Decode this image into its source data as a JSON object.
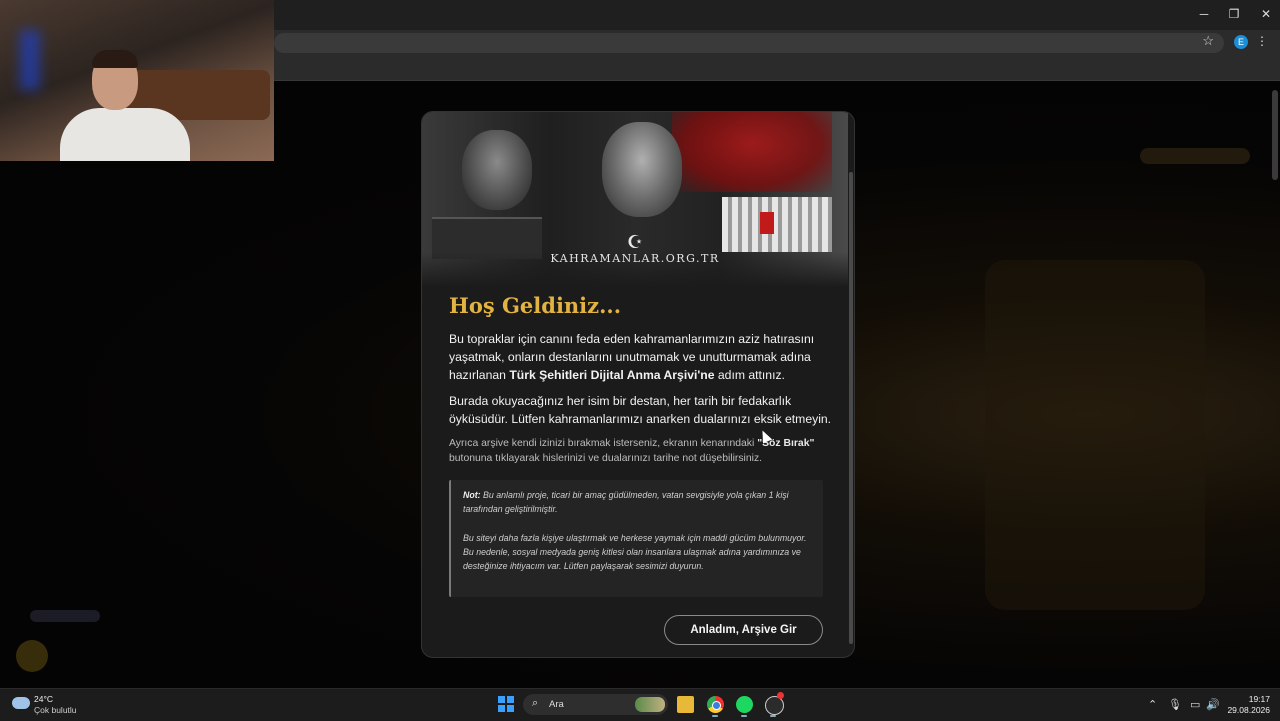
{
  "browser": {
    "window_controls": {
      "minimize": "─",
      "restore": "❐",
      "close": "✕"
    },
    "toolbar": {
      "bookmark_icon": "☆",
      "profile_initial": "E",
      "menu_icon": "⋮"
    }
  },
  "modal": {
    "banner_logo": "KAHRAMANLAR.ORG.TR",
    "banner_logo_symbol": "☪",
    "title": "Hoş Geldiniz...",
    "intro_part1": "Bu topraklar için canını feda eden kahramanlarımızın aziz hatırasını yaşatmak, onların destanlarını unutmamak ve unutturmamak adına hazırlanan ",
    "intro_bold": "Türk Şehitleri Dijital Anma Arşivi'ne",
    "intro_part2": " adım attınız.",
    "paragraph2": "Burada okuyacağınız her isim bir destan, her tarih bir fedakarlık öyküsüdür. Lütfen kahramanlarımızı anarken dualarınızı eksik etmeyin.",
    "paragraph3_part1": "Ayrıca arşive kendi izinizi bırakmak isterseniz, ekranın kenarındaki ",
    "paragraph3_bold": "\"Söz Bırak\"",
    "paragraph3_part2": " butonuna tıklayarak hislerinizi ve dualarınızı tarihe not düşebilirsiniz.",
    "note_label": "Not:",
    "note_line1": " Bu anlamlı proje, ticari bir amaç güdülmeden, vatan sevgisiyle yola çıkan 1 kişi tarafından geliştirilmiştir.",
    "note_line2": "Bu siteyi daha fazla kişiye ulaştırmak ve herkese yaymak için maddi gücüm bulunmuyor. Bu nedenle, sosyal medyada geniş kitlesi olan insanlara ulaşmak adına yardımınıza ve desteğinize ihtiyacım var. Lütfen paylaşarak sesimizi duyurun.",
    "button_label": "Anladım, Arşive Gir"
  },
  "taskbar": {
    "weather_temp": "24°C",
    "weather_desc": "Çok bulutlu",
    "search_label": "Ara",
    "search_icon": "⌕",
    "tray_icons": {
      "chevron": "⌃",
      "mic": "🎙",
      "display": "▭",
      "volume": "🔊"
    },
    "time": "19:17",
    "date": "29.08.2026"
  },
  "colors": {
    "accent_gold": "#e3b341",
    "modal_bg": "#1b1b1b"
  }
}
